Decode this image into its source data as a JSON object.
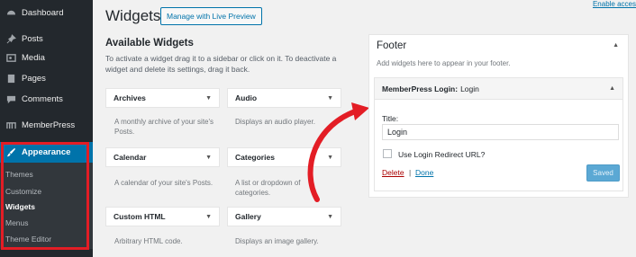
{
  "sidebar": {
    "items": [
      {
        "label": "Dashboard",
        "icon": "dashboard-icon"
      },
      {
        "label": "Posts",
        "icon": "pin-icon"
      },
      {
        "label": "Media",
        "icon": "media-icon"
      },
      {
        "label": "Pages",
        "icon": "page-icon"
      },
      {
        "label": "Comments",
        "icon": "comment-icon"
      },
      {
        "label": "MemberPress",
        "icon": "memberpress-icon"
      },
      {
        "label": "Appearance",
        "icon": "brush-icon"
      }
    ],
    "submenu": [
      "Themes",
      "Customize",
      "Widgets",
      "Menus",
      "Theme Editor"
    ]
  },
  "header": {
    "title": "Widgets",
    "manage_button": "Manage with Live Preview",
    "enable_link": "Enable acces"
  },
  "available": {
    "title": "Available Widgets",
    "description": "To activate a widget drag it to a sidebar or click on it. To deactivate a widget and delete its settings, drag it back.",
    "widgets": [
      {
        "name": "Archives",
        "desc": "A monthly archive of your site's Posts."
      },
      {
        "name": "Audio",
        "desc": "Displays an audio player."
      },
      {
        "name": "Calendar",
        "desc": "A calendar of your site's Posts."
      },
      {
        "name": "Categories",
        "desc": "A list or dropdown of categories."
      },
      {
        "name": "Custom HTML",
        "desc": "Arbitrary HTML code."
      },
      {
        "name": "Gallery",
        "desc": "Displays an image gallery."
      }
    ]
  },
  "footer": {
    "title": "Footer",
    "description": "Add widgets here to appear in your footer.",
    "widget": {
      "name": "MemberPress Login:",
      "subtitle": "Login",
      "field_label": "Title:",
      "field_value": "Login",
      "checkbox_label": "Use Login Redirect URL?",
      "delete_label": "Delete",
      "separator": "|",
      "done_label": "Done",
      "saved_label": "Saved"
    }
  },
  "colors": {
    "sidebar_bg": "#23282d",
    "accent": "#0073aa",
    "highlight": "#e31d25"
  }
}
